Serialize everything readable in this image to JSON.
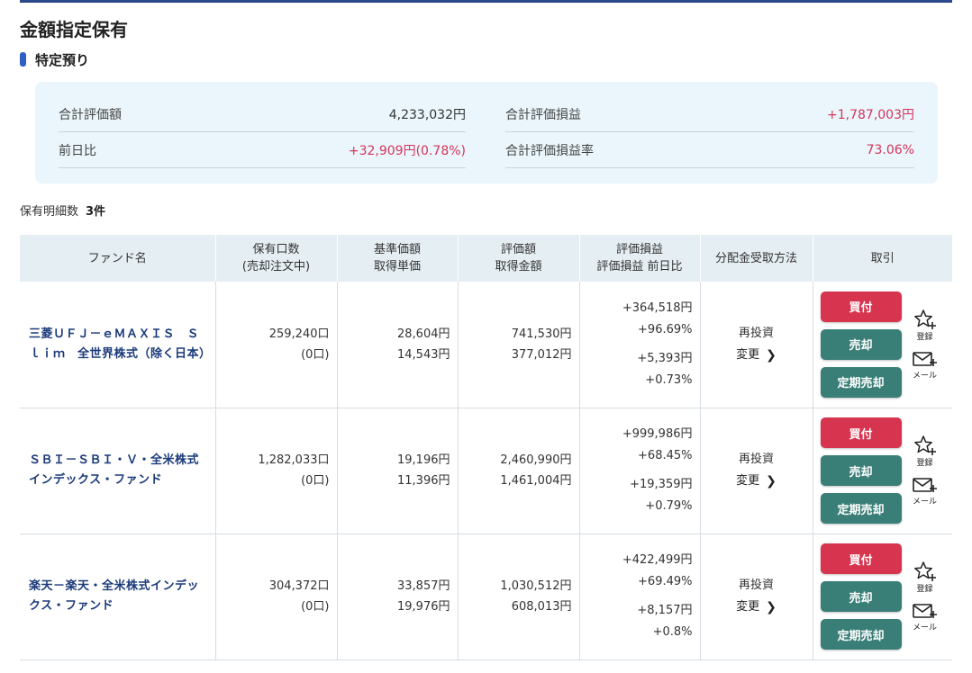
{
  "page": {
    "title": "金額指定保有"
  },
  "section": {
    "label": "特定預り"
  },
  "summary": {
    "total_value_label": "合計評価額",
    "total_value": "4,233,032円",
    "total_pl_label": "合計評価損益",
    "total_pl": "+1,787,003円",
    "day_change_label": "前日比",
    "day_change": "+32,909円(0.78%)",
    "total_pl_rate_label": "合計評価損益率",
    "total_pl_rate": "73.06%"
  },
  "count": {
    "label": "保有明細数",
    "value": "3件"
  },
  "table": {
    "headers": {
      "fund": "ファンド名",
      "units_1": "保有口数",
      "units_2": "(売却注文中)",
      "price_1": "基準価額",
      "price_2": "取得単価",
      "value_1": "評価額",
      "value_2": "取得金額",
      "pl_1": "評価損益",
      "pl_2": "評価損益 前日比",
      "dist": "分配金受取方法",
      "trade": "取引"
    },
    "rows": [
      {
        "fund_name": "三菱ＵＦＪ－ｅＭＡＸＩＳ　Ｓｌｉｍ　全世界株式（除く日本）",
        "units": "259,240口",
        "units_pending": "(0口)",
        "nav": "28,604円",
        "unit_cost": "14,543円",
        "value": "741,530円",
        "cost": "377,012円",
        "pl": "+364,518円",
        "pl_rate": "+96.69%",
        "day_pl": "+5,393円",
        "day_rate": "+0.73%",
        "dist_method": "再投資",
        "change_label": "変更",
        "buy_label": "買付",
        "sell_label": "売却",
        "periodic_sell_label": "定期売却",
        "register_label": "登録",
        "mail_label": "メール"
      },
      {
        "fund_name": "ＳＢＩ－ＳＢＩ・Ｖ・全米株式インデックス・ファンド",
        "units": "1,282,033口",
        "units_pending": "(0口)",
        "nav": "19,196円",
        "unit_cost": "11,396円",
        "value": "2,460,990円",
        "cost": "1,461,004円",
        "pl": "+999,986円",
        "pl_rate": "+68.45%",
        "day_pl": "+19,359円",
        "day_rate": "+0.79%",
        "dist_method": "再投資",
        "change_label": "変更",
        "buy_label": "買付",
        "sell_label": "売却",
        "periodic_sell_label": "定期売却",
        "register_label": "登録",
        "mail_label": "メール"
      },
      {
        "fund_name": "楽天－楽天・全米株式インデックス・ファンド",
        "units": "304,372口",
        "units_pending": "(0口)",
        "nav": "33,857円",
        "unit_cost": "19,976円",
        "value": "1,030,512円",
        "cost": "608,013円",
        "pl": "+422,499円",
        "pl_rate": "+69.49%",
        "day_pl": "+8,157円",
        "day_rate": "+0.8%",
        "dist_method": "再投資",
        "change_label": "変更",
        "buy_label": "買付",
        "sell_label": "売却",
        "periodic_sell_label": "定期売却",
        "register_label": "登録",
        "mail_label": "メール"
      }
    ]
  },
  "colors": {
    "accent_blue": "#2f5fc4",
    "positive_red": "#d6345a",
    "buy_red": "#d6344f",
    "sell_green": "#3a7f77",
    "summary_bg": "#eaf6fb",
    "header_bg": "#e5eef3",
    "fund_link": "#1a3a7a"
  },
  "icons": {
    "register": "star-plus-icon",
    "mail": "mail-plus-icon",
    "change": "chevron-right-icon"
  }
}
